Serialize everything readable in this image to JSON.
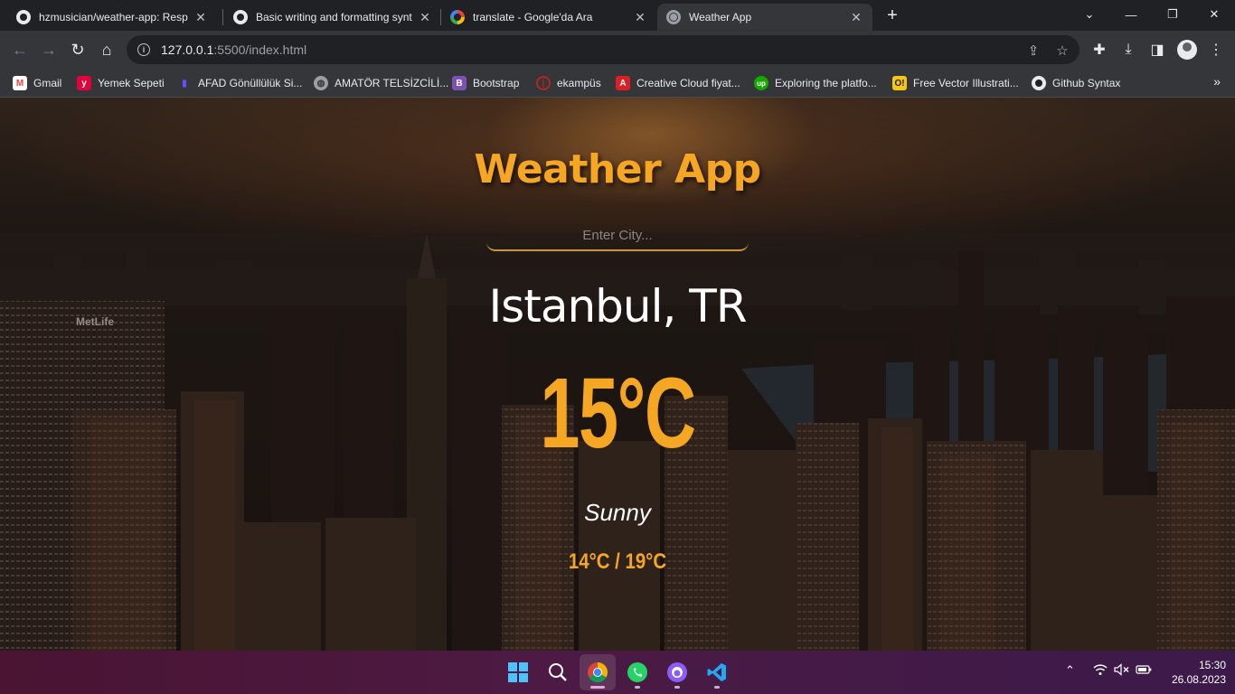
{
  "browser": {
    "tabs": [
      {
        "title": "hzmusician/weather-app: Respon",
        "icon": "github-icon",
        "active": false
      },
      {
        "title": "Basic writing and formatting synt",
        "icon": "github-icon",
        "active": false
      },
      {
        "title": "translate - Google'da Ara",
        "icon": "google-icon",
        "active": false
      },
      {
        "title": "Weather App",
        "icon": "globe-icon",
        "active": true
      }
    ],
    "url_host": "127.0.0.1",
    "url_rest": ":5500/index.html",
    "bookmarks": [
      {
        "label": "Gmail",
        "icon": "gmail-icon",
        "color": "#ea4335"
      },
      {
        "label": "Yemek Sepeti",
        "icon": "yemeksepeti-icon",
        "color": "#e4003a"
      },
      {
        "label": "AFAD Gönüllülük Si...",
        "icon": "afad-icon",
        "color": "#4b2bb8"
      },
      {
        "label": "AMATÖR TELSİZCİLİ...",
        "icon": "globe-icon",
        "color": "#9aa0a6"
      },
      {
        "label": "Bootstrap",
        "icon": "bootstrap-icon",
        "color": "#7952b3"
      },
      {
        "label": "ekampüs",
        "icon": "ekampus-icon",
        "color": "#b3261e"
      },
      {
        "label": "Creative Cloud fiyat...",
        "icon": "adobe-icon",
        "color": "#da1f26"
      },
      {
        "label": "Exploring the platfo...",
        "icon": "upwork-icon",
        "color": "#14a800"
      },
      {
        "label": "Free Vector Illustrati...",
        "icon": "freevector-icon",
        "color": "#f5c518"
      },
      {
        "label": "Github Syntax",
        "icon": "github-icon",
        "color": "#e8eaed"
      }
    ]
  },
  "app": {
    "title": "Weather App",
    "search_placeholder": "Enter City...",
    "city": "Istanbul, TR",
    "temperature": "15°C",
    "condition": "Sunny",
    "min_max": "14°C / 19°C",
    "accent_color": "#f5a623"
  },
  "taskbar": {
    "time": "15:30",
    "date": "26.08.2023",
    "apps": [
      "windows-start-icon",
      "search-icon",
      "chrome-icon",
      "whatsapp-icon",
      "github-desktop-icon",
      "vscode-icon"
    ]
  }
}
